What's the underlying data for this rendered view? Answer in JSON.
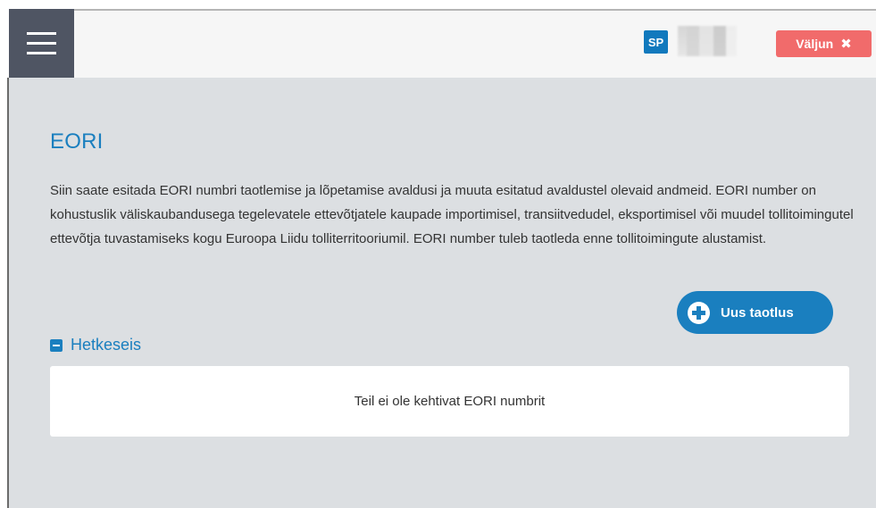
{
  "header": {
    "menu_icon": "hamburger-menu-icon",
    "user_initials": "SP",
    "user_name": "",
    "logout_label": "Väljun",
    "logout_icon": "close-icon"
  },
  "page": {
    "title": "EORI",
    "description": "Siin saate esitada EORI numbri taotlemise ja lõpetamise avaldusi ja muuta esitatud avaldustel olevaid andmeid. EORI number on kohustuslik väliskaubandusega tegelevatele ettevõtjatele kaupade importimisel, transiitvedudel, eksportimisel või muudel tollitoimingutel ettevõtja tuvastamiseks kogu Euroopa Liidu tolliterritooriumil. EORI number tuleb taotleda enne tollitoimingute alustamist.",
    "new_application_label": "Uus taotlus",
    "new_application_icon": "plus-circle-icon"
  },
  "section": {
    "label": "Hetkeseis",
    "toggle_icon": "minus-icon",
    "empty_message": "Teil ei ole kehtivat EORI numbrit"
  },
  "colors": {
    "accent": "#1a7fbf",
    "logout": "#f16b6b",
    "header_menu": "#4f5563",
    "content_bg": "#dcdfe2"
  }
}
